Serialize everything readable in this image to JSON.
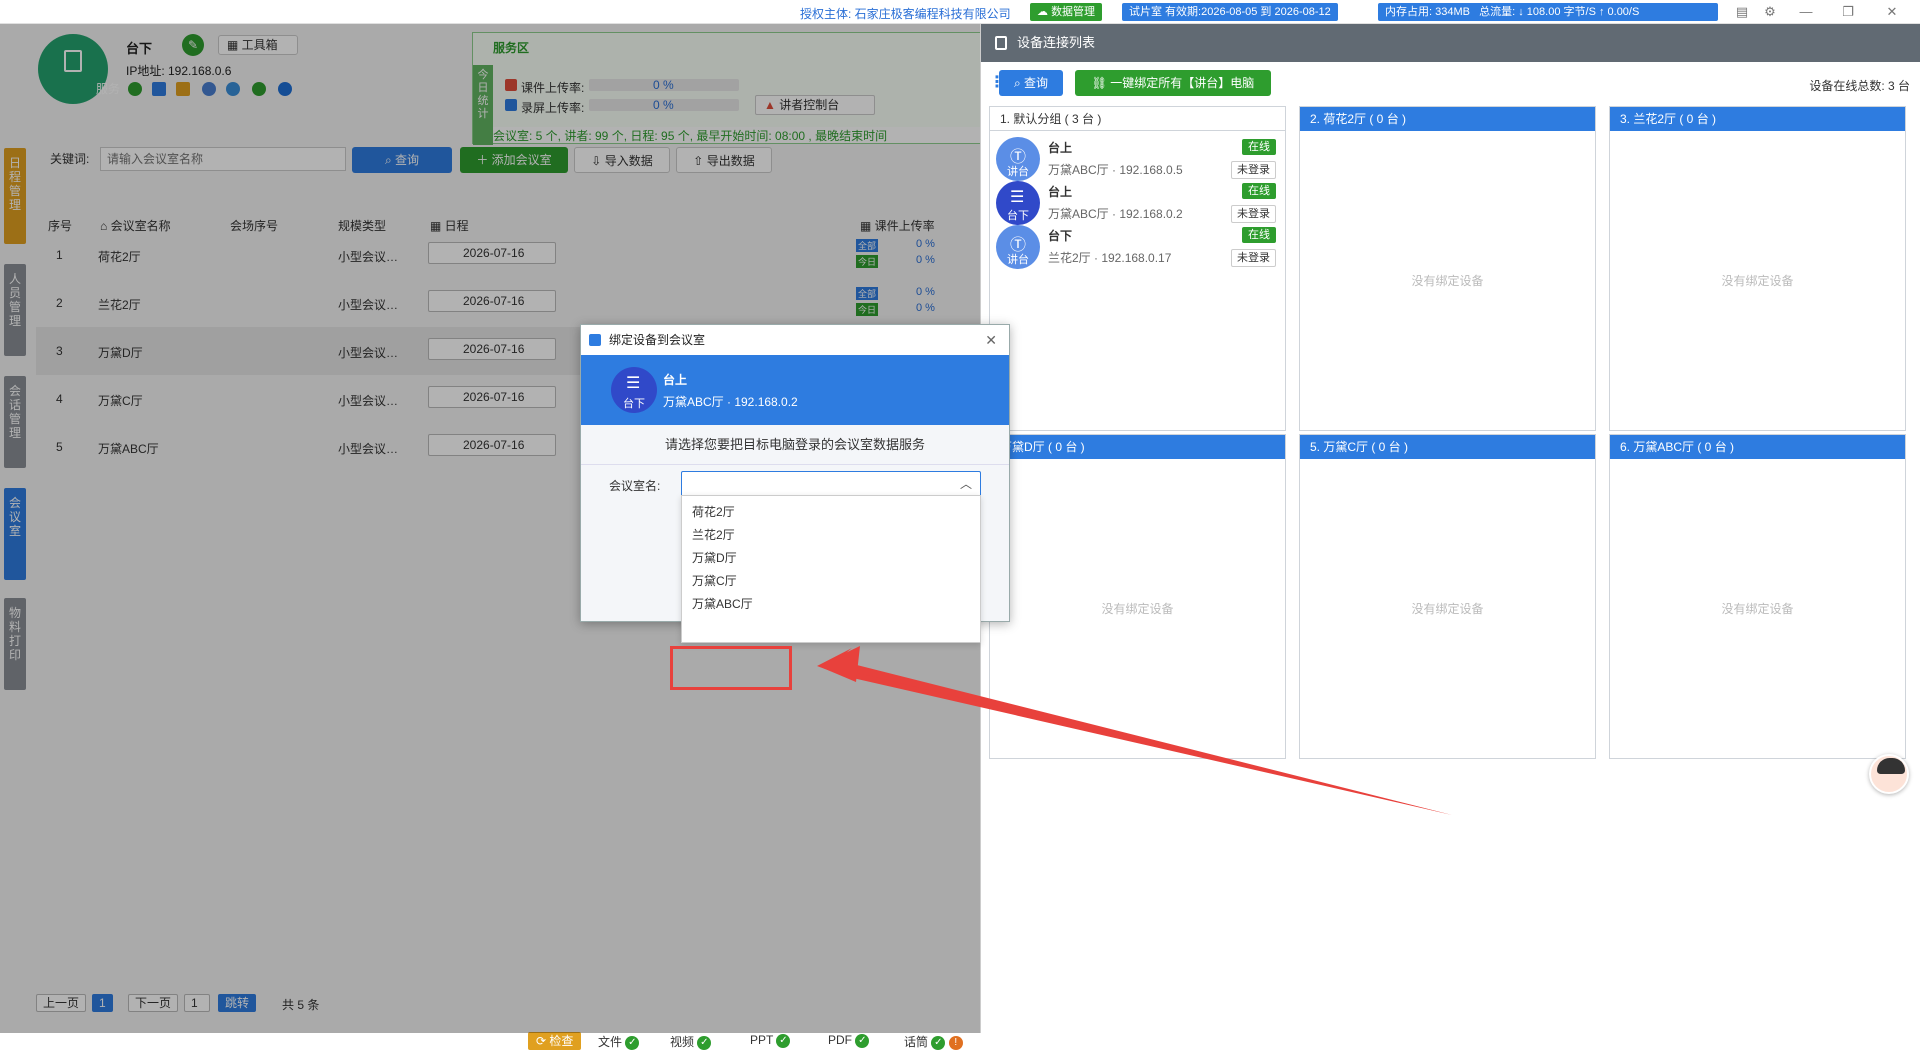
{
  "topbar": {
    "auth_text": "授权主体: 石家庄极客编程科技有限公司",
    "data_mgmt": "数据管理",
    "trial": "试片室 有效期:2026-08-05 到 2026-08-12",
    "memory": "内存占用: 334MB",
    "traffic": "总流量: ↓ 108.00 字节/S  ↑ 0.00/S"
  },
  "header": {
    "logo_label": "服务",
    "device_name": "台下",
    "toolbox": "工具箱",
    "ip": "IP地址: 192.168.0.6"
  },
  "service": {
    "title": "服务区",
    "side": "今日统计",
    "upload_label": "课件上传率:",
    "upload_pct": "0 %",
    "record_label": "录屏上传率:",
    "record_pct": "0 %",
    "console_btn": "讲者控制台",
    "stats_line": "会议室: 5 个, 讲者: 99 个, 日程: 95 个, 最早开始时间: 08:00 , 最晚结束时间"
  },
  "sidetabs": [
    "日程管理",
    "人员管理",
    "会话管理",
    "会议室",
    "物料打印"
  ],
  "search": {
    "keyword_label": "关键词:",
    "placeholder": "请输入会议室名称",
    "query_btn": "查询",
    "add_btn": "添加会议室",
    "import_btn": "导入数据",
    "export_btn": "导出数据"
  },
  "table": {
    "headers": [
      "序号",
      "会议室名称",
      "会场序号",
      "规模类型",
      "日程",
      "课件上传率"
    ],
    "rows": [
      {
        "no": "1",
        "name": "荷花2厅",
        "type": "小型会议…",
        "date": "2026-07-16"
      },
      {
        "no": "2",
        "name": "兰花2厅",
        "type": "小型会议…",
        "date": "2026-07-16"
      },
      {
        "no": "3",
        "name": "万黛D厅",
        "type": "小型会议…",
        "date": "2026-07-16"
      },
      {
        "no": "4",
        "name": "万黛C厅",
        "type": "小型会议…",
        "date": "2026-07-16"
      },
      {
        "no": "5",
        "name": "万黛ABC厅",
        "type": "小型会议…",
        "date": "2026-07-16"
      }
    ],
    "upload_all": "全部",
    "upload_today": "今日",
    "upload_value": "0 %"
  },
  "pager": {
    "prev": "上一页",
    "current": "1",
    "next": "下一页",
    "input": "1",
    "jump": "跳转",
    "total": "共 5 条"
  },
  "statusbar": {
    "check": "检查",
    "items": [
      "文件",
      "视频",
      "PPT",
      "PDF",
      "话筒"
    ]
  },
  "rpanel": {
    "title": "设备连接列表",
    "query_btn": "查询",
    "bind_all_btn": "一键绑定所有【讲台】电脑",
    "online_total": "设备在线总数: 3 台",
    "empty_text": "没有绑定设备",
    "groups": [
      "1. 默认分组 ( 3 台 )",
      "2. 荷花2厅 ( 0 台 )",
      "3. 兰花2厅 ( 0 台 )",
      "万黛D厅 ( 0 台 )",
      "5. 万黛C厅 ( 0 台 )",
      "6. 万黛ABC厅 ( 0 台 )"
    ],
    "devices": [
      {
        "avatar": "讲台",
        "name": "台上",
        "info": "万黛ABC厅 · 192.168.0.5",
        "status": "在线",
        "login": "未登录",
        "color": "#5b8ee6"
      },
      {
        "avatar": "台下",
        "name": "台上",
        "info": "万黛ABC厅 · 192.168.0.2",
        "status": "在线",
        "login": "未登录",
        "color": "#3049c9"
      },
      {
        "avatar": "讲台",
        "name": "台下",
        "info": "兰花2厅 · 192.168.0.17",
        "status": "在线",
        "login": "未登录",
        "color": "#5b8ee6"
      }
    ]
  },
  "dialog": {
    "title": "绑定设备到会议室",
    "avatar": "台下",
    "device_name": "台上",
    "device_info": "万黛ABC厅 · 192.168.0.2",
    "prompt": "请选择您要把目标电脑登录的会议室数据服务",
    "field_label": "会议室名:",
    "options": [
      "荷花2厅",
      "兰花2厅",
      "万黛D厅",
      "万黛C厅",
      "万黛ABC厅"
    ]
  }
}
